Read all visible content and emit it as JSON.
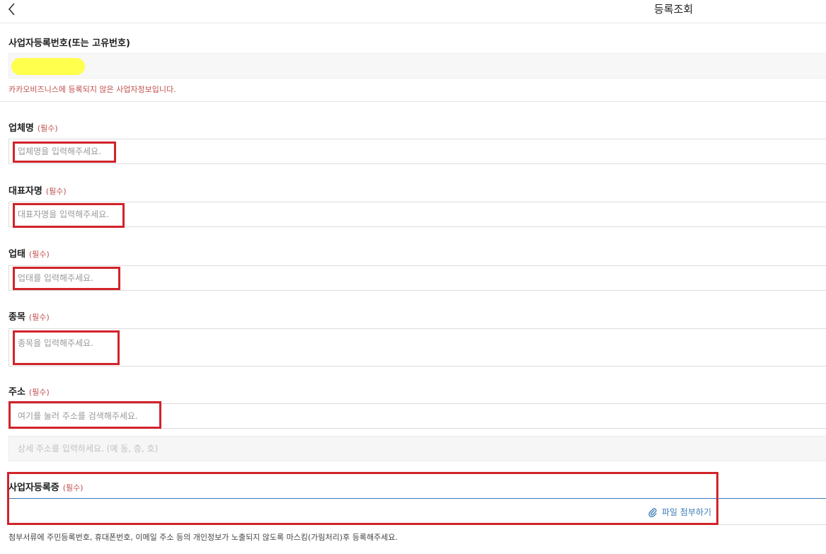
{
  "header": {
    "title": "등록조회"
  },
  "biz_number": {
    "label": "사업자등록번호(또는 고유번호)",
    "error": "카카오비즈니스에 등록되지 않은 사업자정보입니다."
  },
  "required_text": "(필수)",
  "fields": {
    "company": {
      "label": "업체명",
      "placeholder": "업체명을 입력해주세요."
    },
    "ceo": {
      "label": "대표자명",
      "placeholder": "대표자명을 입력해주세요."
    },
    "business_type": {
      "label": "업태",
      "placeholder": "업태를 입력해주세요."
    },
    "business_item": {
      "label": "종목",
      "placeholder": "종목을 입력해주세요."
    },
    "address": {
      "label": "주소",
      "placeholder": "여기를 눌러 주소를 검색해주세요.",
      "detail_placeholder": "상세 주소를 입력하세요. (예 동, 층, 호)"
    }
  },
  "certificate": {
    "label": "사업자등록증",
    "attach_label": "파일 첨부하기",
    "notice": "첨부서류에 주민등록번호, 휴대폰번호, 이메일 주소 등의 개인정보가 노출되지 않도록 마스킹(가림처리)후 등록해주세요."
  },
  "colors": {
    "required": "#c0504d",
    "link": "#3b7bb8",
    "annotation": "#d1232a",
    "highlight": "#ffff3a"
  },
  "icons": {
    "back": "chevron-left-icon",
    "attach": "paperclip-icon"
  }
}
